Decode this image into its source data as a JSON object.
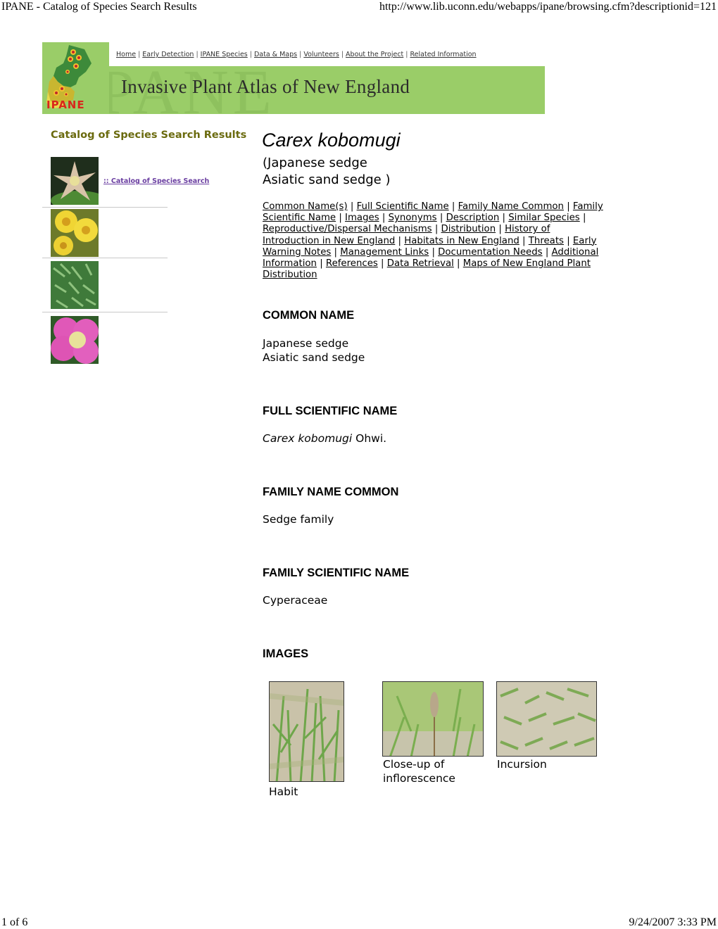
{
  "print_header": {
    "title": "IPANE - Catalog of Species Search Results",
    "url": "http://www.lib.uconn.edu/webapps/ipane/browsing.cfm?descriptionid=121"
  },
  "print_footer": {
    "page": "1 of 6",
    "datetime": "9/24/2007 3:33 PM"
  },
  "banner": {
    "title": "Invasive Plant Atlas of New England",
    "watermark": "IPANE",
    "logo_text": "IPANE",
    "color": "#9acd68",
    "nav": [
      "Home",
      "Early Detection",
      "IPANE Species",
      "Data & Maps",
      "Volunteers",
      "About the Project",
      "Related Information"
    ]
  },
  "sidebar": {
    "title": "Catalog of Species Search Results",
    "link": ":: Catalog of Species Search",
    "thumbnails": [
      "star-flower",
      "yellow-flowers",
      "green-foliage",
      "pink-rose"
    ]
  },
  "species": {
    "name": "Carex kobomugi",
    "common_line1": "(Japanese sedge",
    "common_line2": "Asiatic sand sedge )"
  },
  "toc": [
    "Common Name(s)",
    "Full Scientific Name",
    "Family Name Common",
    "Family Scientific Name",
    "Images",
    "Synonyms",
    "Description",
    "Similar Species",
    "Reproductive/Dispersal Mechanisms",
    "Distribution",
    "History of Introduction in New England",
    "Habitats in New England",
    "Threats",
    "Early Warning Notes",
    "Management Links",
    "Documentation Needs",
    "Additional Information",
    "References",
    "Data Retrieval",
    "Maps of New England Plant Distribution"
  ],
  "sections": {
    "common_name": {
      "heading": "COMMON NAME",
      "line1": "Japanese sedge",
      "line2": "Asiatic sand sedge"
    },
    "full_scientific_name": {
      "heading": "FULL SCIENTIFIC NAME",
      "italic": "Carex kobomugi",
      "author": " Ohwi."
    },
    "family_name_common": {
      "heading": "FAMILY NAME COMMON",
      "value": "Sedge family"
    },
    "family_scientific_name": {
      "heading": "FAMILY SCIENTIFIC NAME",
      "value": "Cyperaceae"
    },
    "images": {
      "heading": "IMAGES",
      "items": [
        {
          "caption": "Habit"
        },
        {
          "caption": "Close-up of inflorescence"
        },
        {
          "caption": "Incursion"
        }
      ]
    }
  }
}
